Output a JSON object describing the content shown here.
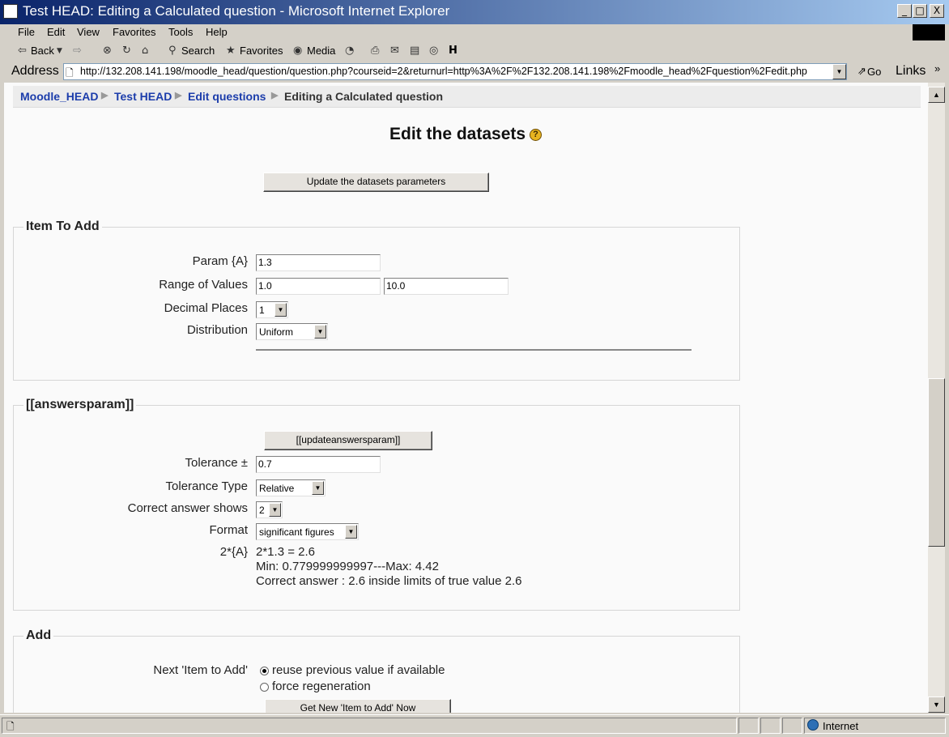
{
  "window": {
    "title": "Test HEAD: Editing a Calculated question - Microsoft Internet Explorer",
    "min_glyph": "_",
    "max_glyph": "□",
    "close_glyph": "X"
  },
  "menu": [
    "File",
    "Edit",
    "View",
    "Favorites",
    "Tools",
    "Help"
  ],
  "toolbar": {
    "back": "Back",
    "search": "Search",
    "favorites": "Favorites",
    "media": "Media"
  },
  "address": {
    "label": "Address",
    "url": "http://132.208.141.198/moodle_head/question/question.php?courseid=2&returnurl=http%3A%2F%2F132.208.141.198%2Fmoodle_head%2Fquestion%2Fedit.php",
    "go": "Go",
    "links": "Links"
  },
  "breadcrumb": {
    "items": [
      "Moodle_HEAD",
      "Test HEAD",
      "Edit questions"
    ],
    "current": "Editing a Calculated question",
    "separator": "▶"
  },
  "page": {
    "heading": "Edit the datasets",
    "help_glyph": "?",
    "update_button": "Update the datasets parameters"
  },
  "item_to_add": {
    "legend": "Item To Add",
    "param_label": "Param {A}",
    "param_value": "1.3",
    "range_label": "Range of Values",
    "range_min": "1.0",
    "range_max": "10.0",
    "decimal_label": "Decimal Places",
    "decimal_value": "1",
    "distribution_label": "Distribution",
    "distribution_value": "Uniform"
  },
  "answers": {
    "legend": "[[answersparam]]",
    "update_button": "[[updateanswersparam]]",
    "tolerance_label": "Tolerance ±",
    "tolerance_value": "0.7",
    "tolerance_type_label": "Tolerance Type",
    "tolerance_type_value": "Relative",
    "correct_label": "Correct answer shows",
    "correct_value": "2",
    "format_label": "Format",
    "format_value": "significant figures",
    "formula_label": "2*{A}",
    "formula_result": "2*1.3 = 2.6",
    "min_max": "Min: 0.779999999997---Max: 4.42",
    "correct_text": "Correct answer : 2.6 inside limits of true value 2.6"
  },
  "add": {
    "legend": "Add",
    "next_label": "Next 'Item to Add'",
    "option_reuse": "reuse previous value if available",
    "option_force": "force regeneration",
    "get_new_button": "Get New 'Item to Add' Now"
  },
  "status": {
    "zone": "Internet"
  }
}
